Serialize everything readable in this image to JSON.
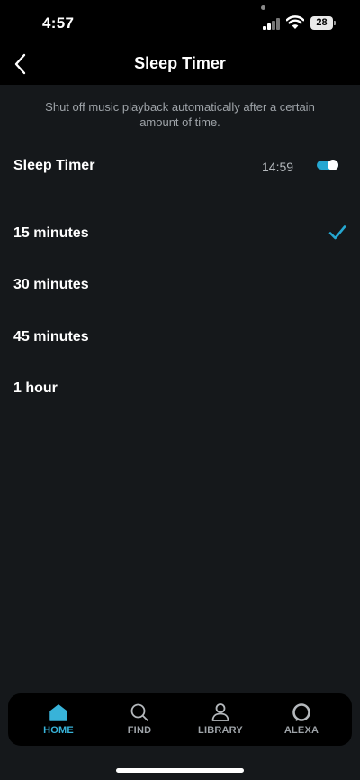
{
  "status_bar": {
    "time": "4:57",
    "battery": "28",
    "icons": [
      "signal-icon",
      "wifi-icon",
      "battery-icon"
    ]
  },
  "header": {
    "title": "Sleep Timer",
    "back_icon": "chevron-left-icon"
  },
  "description": "Shut off music playback automatically after a certain amount of time.",
  "timer": {
    "label": "Sleep Timer",
    "remaining": "14:59",
    "enabled": true
  },
  "options": [
    {
      "label": "15 minutes",
      "selected": true
    },
    {
      "label": "30 minutes",
      "selected": false
    },
    {
      "label": "45 minutes",
      "selected": false
    },
    {
      "label": "1 hour",
      "selected": false
    }
  ],
  "bottom_nav": [
    {
      "label": "HOME",
      "icon": "home-icon",
      "active": true
    },
    {
      "label": "FIND",
      "icon": "search-icon",
      "active": false
    },
    {
      "label": "LIBRARY",
      "icon": "library-icon",
      "active": false
    },
    {
      "label": "ALEXA",
      "icon": "alexa-icon",
      "active": false
    }
  ],
  "colors": {
    "accent": "#25a7d1",
    "background": "#15181b",
    "header": "#000000"
  }
}
